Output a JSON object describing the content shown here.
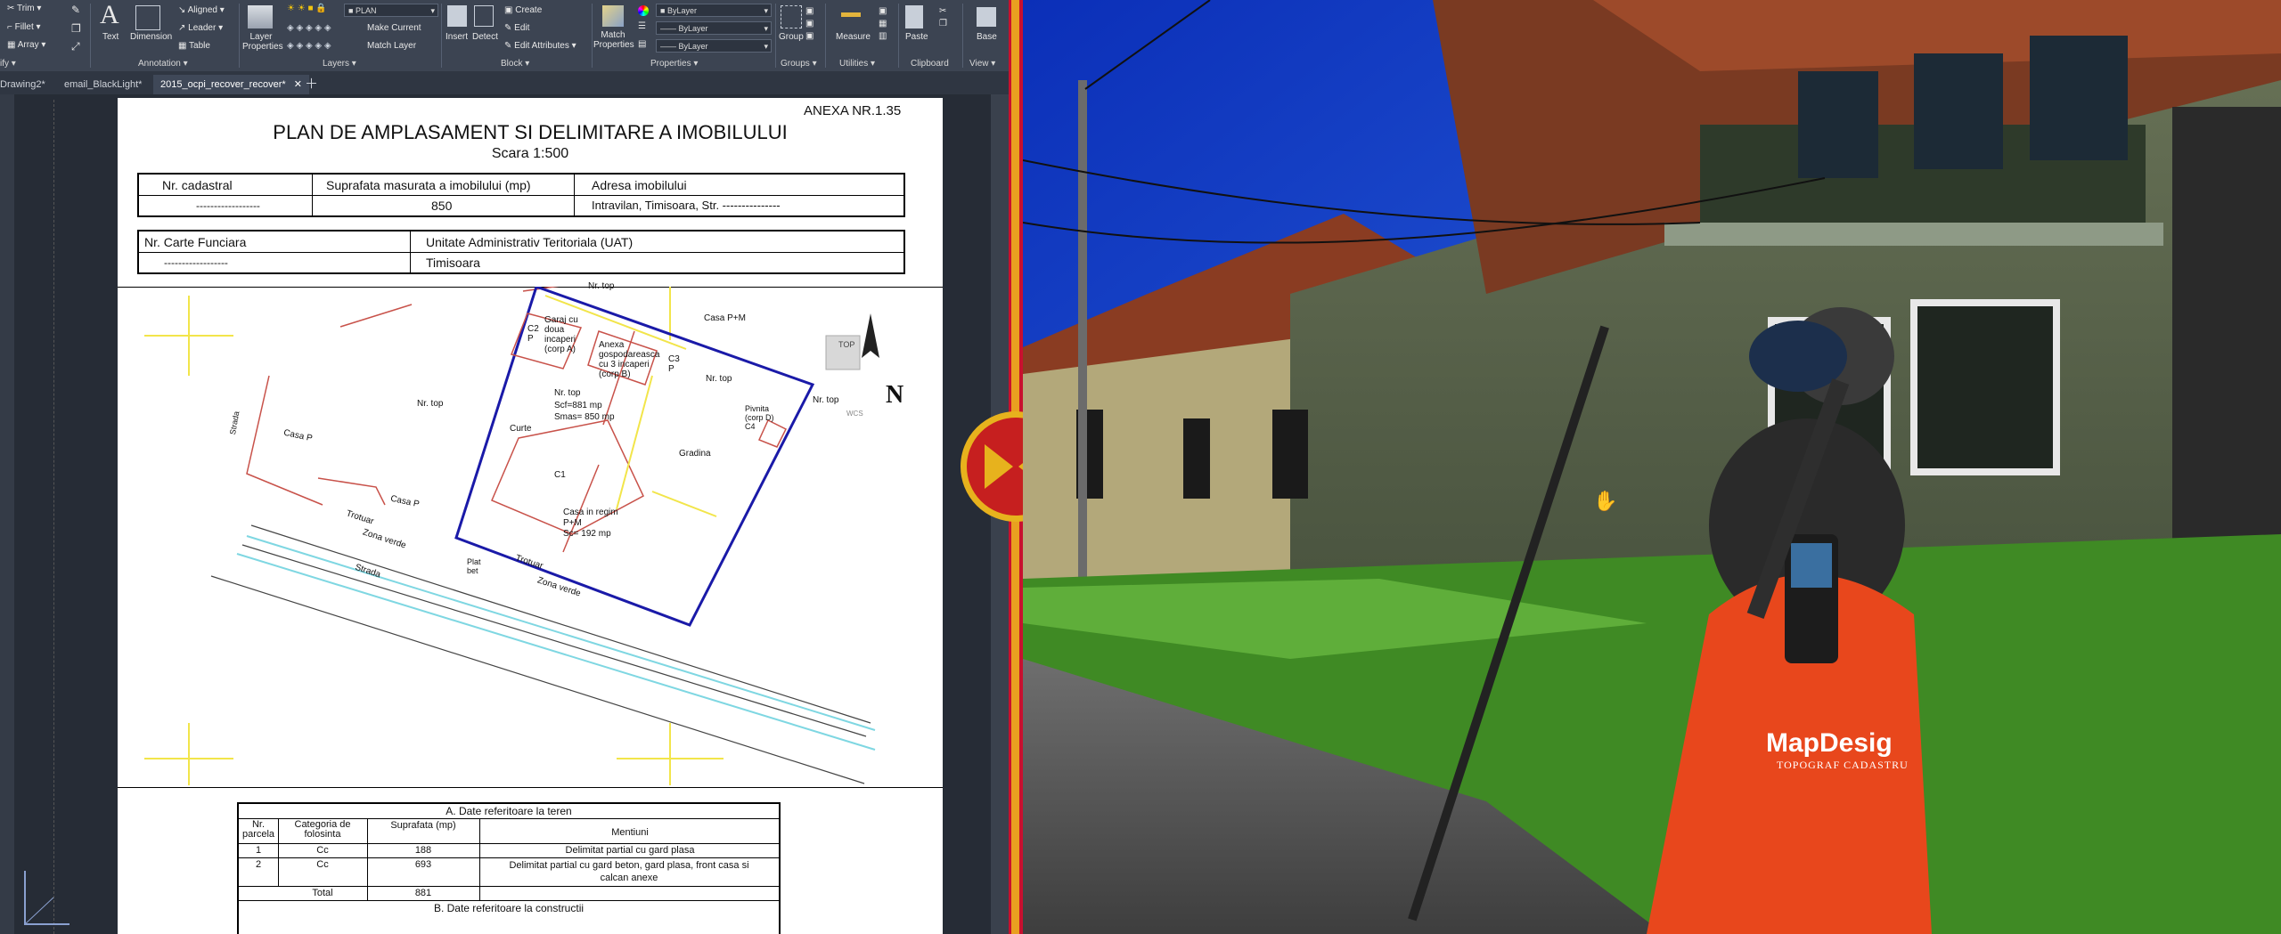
{
  "ribbon": {
    "modify": {
      "trim": "Trim",
      "fillet": "Fillet",
      "array": "Array",
      "panel": "ify"
    },
    "annotation": {
      "text": "Text",
      "dimension": "Dimension",
      "aligned": "Aligned",
      "leader": "Leader",
      "table": "Table",
      "panel": "Annotation"
    },
    "layers": {
      "layer_properties": "Layer Properties",
      "layer_combo": "PLAN",
      "make_current": "Make Current",
      "match_layer": "Match Layer",
      "panel": "Layers"
    },
    "block": {
      "insert": "Insert",
      "detect": "Detect",
      "create": "Create",
      "edit": "Edit",
      "edit_attributes": "Edit Attributes",
      "panel": "Block"
    },
    "properties": {
      "match_properties": "Match Properties",
      "bylayer_1": "ByLayer",
      "bylayer_2": "ByLayer",
      "bylayer_3": "ByLayer",
      "panel": "Properties"
    },
    "groups": {
      "group": "Group",
      "panel": "Groups"
    },
    "utilities": {
      "measure": "Measure",
      "panel": "Utilities"
    },
    "clipboard": {
      "paste": "Paste",
      "panel": "Clipboard"
    },
    "view": {
      "base": "Base",
      "panel": "View"
    }
  },
  "tabs": [
    "Drawing2*",
    "email_BlackLight*",
    "2015_ocpi_recover_recover*"
  ],
  "drawing": {
    "annex": "ANEXA NR.1.35",
    "title": "PLAN DE AMPLASAMENT SI DELIMITARE A IMOBILULUI",
    "scale": "Scara 1:500",
    "t1_h1": "Nr. cadastral",
    "t1_h2": "Suprafata masurata  a imobilului (mp)",
    "t1_h3": "Adresa imobilului",
    "t1_v1": "------------------",
    "t1_v2": "850",
    "t1_v3": "Intravilan, Timisoara, Str. ---------------",
    "t2_h1": "Nr. Carte Funciara",
    "t2_h2": "Unitate Administrativ Teritoriala (UAT)",
    "t2_v1": "------------------",
    "t2_v2": "Timisoara",
    "plan": {
      "nrtop_top": "Nr. top",
      "casa_pm": "Casa P+M",
      "garaj": "Garaj cu doua incaperi (corp A)",
      "c2p": "C2 P",
      "anexa": "Anexa gospodareasca cu 3 incaperi (corp B)",
      "c3p": "C3 P",
      "anexa_v": "Anexa",
      "nrtop_mid": "Nr. top",
      "scf": "Scf=881 mp",
      "smas": "Smas= 850 mp",
      "curte": "Curte",
      "gradina": "Gradina",
      "c1": "C1",
      "casa_regim": "Casa in regim",
      "pm": "P+M",
      "sc": "Sc= 192 mp",
      "pivnita": "Pivnita (corp D) C4",
      "nrtop_left": "Nr. top",
      "casa_p1": "Casa P",
      "casa_p2": "Casa P",
      "strada_v": "Strada",
      "trotuar1": "Trotuar",
      "zona1": "Zona verde",
      "strada": "Strada",
      "trotuar2": "Trotuar",
      "zona2": "Zona verde",
      "platbet": "Plat bet",
      "nrtop_right": "Nr. top",
      "nrtop_far": "Nr. top",
      "top": "TOP",
      "north": "N",
      "wcs": "WCS"
    },
    "t3": {
      "title": "A. Date referitoare la teren",
      "headers": [
        "Nr. parcela",
        "Categoria de folosinta",
        "Suprafata (mp)",
        "Mentiuni"
      ],
      "rows": [
        [
          "1",
          "Cc",
          "188",
          "Delimitat partial cu gard plasa"
        ],
        [
          "2",
          "Cc",
          "693",
          "Delimitat partial cu gard beton, gard plasa, front casa si calcan anexe"
        ]
      ],
      "total_label": "Total",
      "total_value": "881",
      "next": "B. Date referitoare la constructii"
    }
  },
  "photo": {
    "shirt_brand": "MapDesig",
    "shirt_tag": "TOPOGRAF    CADASTRU"
  },
  "colors": {
    "accent_red": "#c61f1f",
    "accent_yellow": "#e7b21d",
    "ribbon_bg": "#3c4452",
    "boundary_blue": "#1a1aa8",
    "parcel_red": "#c8524a"
  }
}
